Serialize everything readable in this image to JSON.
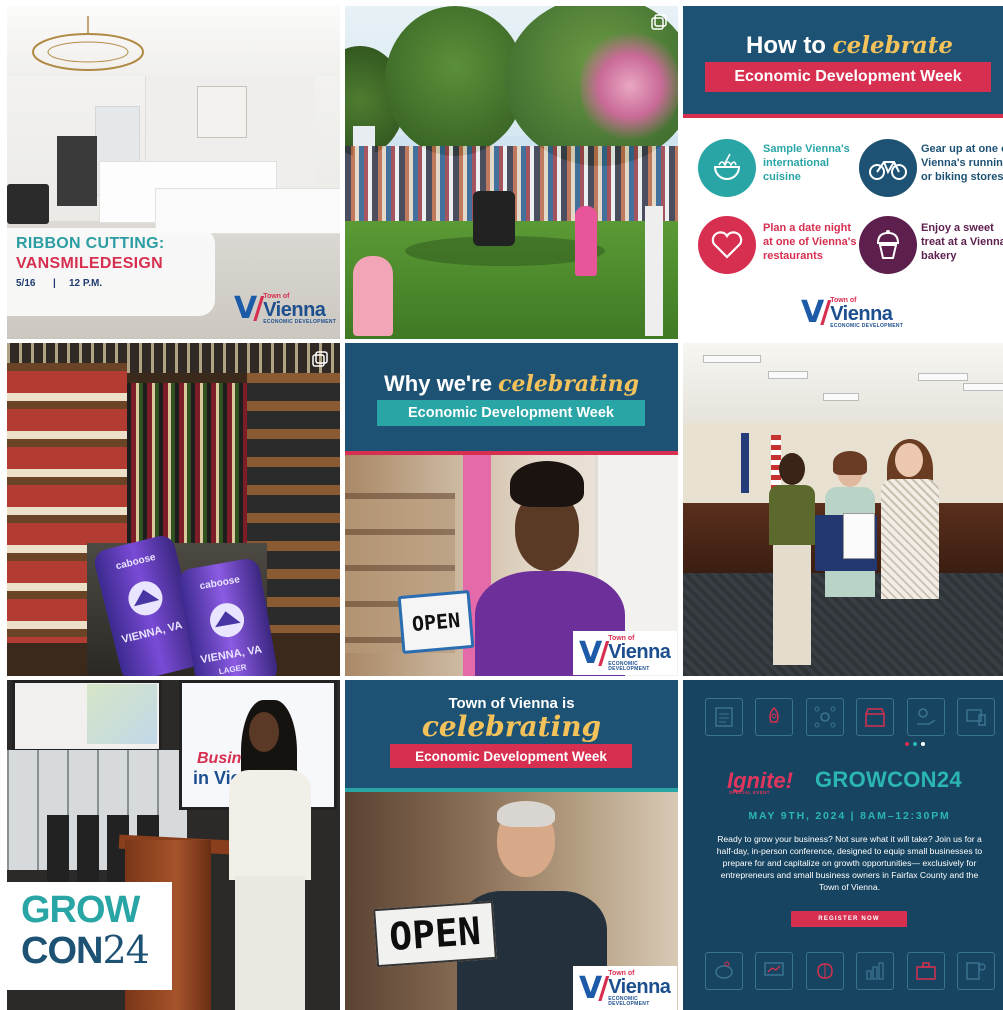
{
  "grid": {
    "posts": [
      {
        "id": "post-1",
        "kind": "ribbon-cutting"
      },
      {
        "id": "post-2",
        "kind": "park-concert-photo"
      },
      {
        "id": "post-3",
        "kind": "how-to-celebrate"
      },
      {
        "id": "post-4",
        "kind": "store-photo"
      },
      {
        "id": "post-5",
        "kind": "why-celebrating"
      },
      {
        "id": "post-6",
        "kind": "council-photo"
      },
      {
        "id": "post-7",
        "kind": "speaker-photo"
      },
      {
        "id": "post-8",
        "kind": "town-celebrating"
      },
      {
        "id": "post-9",
        "kind": "growcon-event"
      }
    ]
  },
  "logo": {
    "town_of": "Town of",
    "vienna": "Vienna",
    "econ_dev": "ECONOMIC DEVELOPMENT",
    "colors": {
      "blue": "#1d5ba8",
      "red": "#d72f50"
    }
  },
  "post1": {
    "title_line1": "RIBBON CUTTING:",
    "title_line2": "VANSMILEDESIGN",
    "date": "5/16",
    "separator": "|",
    "time": "12 P.M."
  },
  "post3": {
    "heading_plain": "How to",
    "heading_script": "celebrate",
    "banner": "Economic Development Week",
    "items": [
      {
        "text": "Sample Vienna's international cuisine",
        "icon": "noodle-bowl-icon",
        "color": "#2aa5a6"
      },
      {
        "text": "Gear up at one of Vienna's running or biking stores",
        "icon": "bicycle-icon",
        "color": "#1d5275"
      },
      {
        "text": "Plan a date night at one of Vienna's restaurants",
        "icon": "heart-icon",
        "color": "#d72f50"
      },
      {
        "text": "Enjoy a sweet treat at a Vienna bakery",
        "icon": "cupcake-icon",
        "color": "#5d1f4d"
      }
    ]
  },
  "post4": {
    "can_brand": "caboose",
    "can_text": "VIENNA, VA",
    "can_style": "LAGER"
  },
  "post5": {
    "heading_plain": "Why we're",
    "heading_script": "celebrating",
    "banner": "Economic Development Week",
    "sign": "OPEN"
  },
  "post7": {
    "screen_title": "Business",
    "screen_sub": "in Vienna!",
    "grow": "GROW",
    "con": "CON",
    "year": "24"
  },
  "post8": {
    "heading_plain": "Town of Vienna is",
    "heading_script": "celebrating",
    "banner": "Economic Development Week",
    "sign": "OPEN"
  },
  "post9": {
    "ignite": "Ignite!",
    "ignite_sub": "SPECIAL EVENT",
    "grow": "GROW",
    "con": "CON",
    "year": "24",
    "date_line": "MAY 9TH, 2024 | 8AM–12:30PM",
    "body": "Ready to grow your business? Not sure what it will take? Join us for a half-day, in-person conference, designed to equip small businesses to prepare for and capitalize on growth opportunities— exclusively for entrepreneurs and small business owners in Fairfax County and the Town of Vienna.",
    "cta": "REGISTER NOW",
    "colors": {
      "bg": "#174561",
      "teal": "#2bb6b3",
      "red": "#d72f50"
    }
  }
}
